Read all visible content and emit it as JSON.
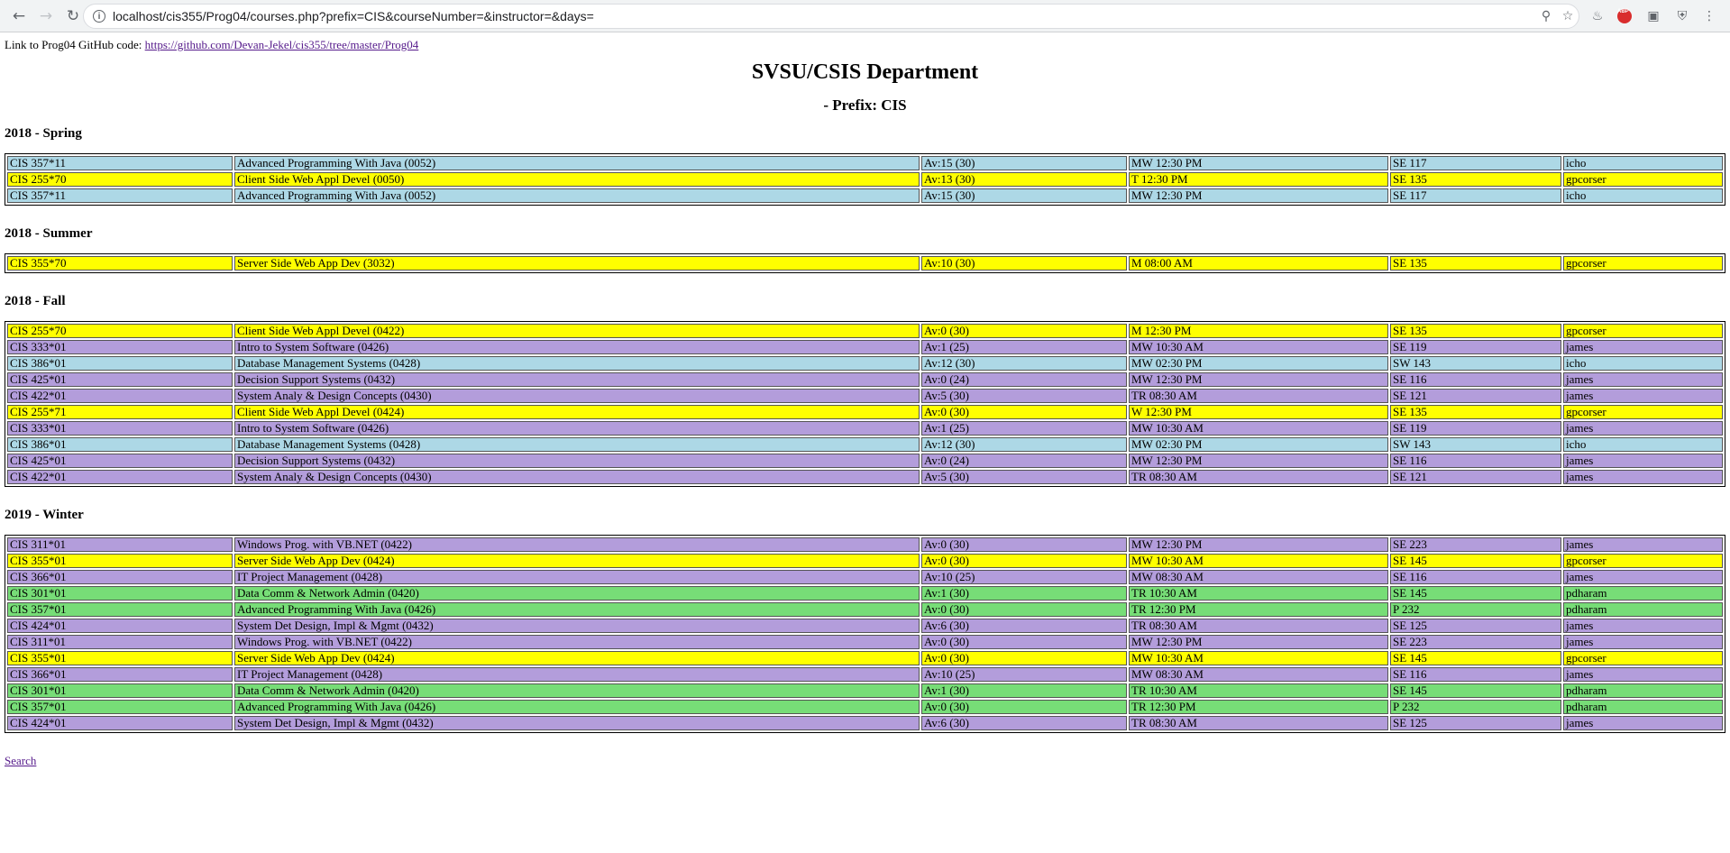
{
  "browser": {
    "url": "localhost/cis355/Prog04/courses.php?prefix=CIS&courseNumber=&instructor=&days="
  },
  "page": {
    "github_label": "Link to Prog04 GitHub code: ",
    "github_link": "https://github.com/Devan-Jekel/cis355/tree/master/Prog04",
    "title": "SVSU/CSIS Department",
    "subtitle": "- Prefix: CIS",
    "search_link": "Search"
  },
  "colors": {
    "blue": "#add8e6",
    "yellow": "#ffff00",
    "purple": "#b39ddb",
    "green": "#77dd77"
  },
  "terms": [
    {
      "title": "2018 - Spring",
      "rows": [
        {
          "color": "blue",
          "course": "CIS 357*11",
          "title": "Advanced Programming With Java (0052)",
          "avail": "Av:15 (30)",
          "time": "MW 12:30 PM",
          "room": "SE 117",
          "instructor": "icho"
        },
        {
          "color": "yellow",
          "course": "CIS 255*70",
          "title": "Client Side Web Appl Devel (0050)",
          "avail": "Av:13 (30)",
          "time": "T 12:30 PM",
          "room": "SE 135",
          "instructor": "gpcorser"
        },
        {
          "color": "blue",
          "course": "CIS 357*11",
          "title": "Advanced Programming With Java (0052)",
          "avail": "Av:15 (30)",
          "time": "MW 12:30 PM",
          "room": "SE 117",
          "instructor": "icho"
        }
      ]
    },
    {
      "title": "2018 - Summer",
      "rows": [
        {
          "color": "yellow",
          "course": "CIS 355*70",
          "title": "Server Side Web App Dev (3032)",
          "avail": "Av:10 (30)",
          "time": "M 08:00 AM",
          "room": "SE 135",
          "instructor": "gpcorser"
        }
      ]
    },
    {
      "title": "2018 - Fall",
      "rows": [
        {
          "color": "yellow",
          "course": "CIS 255*70",
          "title": "Client Side Web Appl Devel (0422)",
          "avail": "Av:0 (30)",
          "time": "M 12:30 PM",
          "room": "SE 135",
          "instructor": "gpcorser"
        },
        {
          "color": "purple",
          "course": "CIS 333*01",
          "title": "Intro to System Software (0426)",
          "avail": "Av:1 (25)",
          "time": "MW 10:30 AM",
          "room": "SE 119",
          "instructor": "james"
        },
        {
          "color": "blue",
          "course": "CIS 386*01",
          "title": "Database Management Systems (0428)",
          "avail": "Av:12 (30)",
          "time": "MW 02:30 PM",
          "room": "SW 143",
          "instructor": "icho"
        },
        {
          "color": "purple",
          "course": "CIS 425*01",
          "title": "Decision Support Systems (0432)",
          "avail": "Av:0 (24)",
          "time": "MW 12:30 PM",
          "room": "SE 116",
          "instructor": "james"
        },
        {
          "color": "purple",
          "course": "CIS 422*01",
          "title": "System Analy & Design Concepts (0430)",
          "avail": "Av:5 (30)",
          "time": "TR 08:30 AM",
          "room": "SE 121",
          "instructor": "james"
        },
        {
          "color": "yellow",
          "course": "CIS 255*71",
          "title": "Client Side Web Appl Devel (0424)",
          "avail": "Av:0 (30)",
          "time": "W 12:30 PM",
          "room": "SE 135",
          "instructor": "gpcorser"
        },
        {
          "color": "purple",
          "course": "CIS 333*01",
          "title": "Intro to System Software (0426)",
          "avail": "Av:1 (25)",
          "time": "MW 10:30 AM",
          "room": "SE 119",
          "instructor": "james"
        },
        {
          "color": "blue",
          "course": "CIS 386*01",
          "title": "Database Management Systems (0428)",
          "avail": "Av:12 (30)",
          "time": "MW 02:30 PM",
          "room": "SW 143",
          "instructor": "icho"
        },
        {
          "color": "purple",
          "course": "CIS 425*01",
          "title": "Decision Support Systems (0432)",
          "avail": "Av:0 (24)",
          "time": "MW 12:30 PM",
          "room": "SE 116",
          "instructor": "james"
        },
        {
          "color": "purple",
          "course": "CIS 422*01",
          "title": "System Analy & Design Concepts (0430)",
          "avail": "Av:5 (30)",
          "time": "TR 08:30 AM",
          "room": "SE 121",
          "instructor": "james"
        }
      ]
    },
    {
      "title": "2019 - Winter",
      "rows": [
        {
          "color": "purple",
          "course": "CIS 311*01",
          "title": "Windows Prog. with VB.NET (0422)",
          "avail": "Av:0 (30)",
          "time": "MW 12:30 PM",
          "room": "SE 223",
          "instructor": "james"
        },
        {
          "color": "yellow",
          "course": "CIS 355*01",
          "title": "Server Side Web App Dev (0424)",
          "avail": "Av:0 (30)",
          "time": "MW 10:30 AM",
          "room": "SE 145",
          "instructor": "gpcorser"
        },
        {
          "color": "purple",
          "course": "CIS 366*01",
          "title": "IT Project Management (0428)",
          "avail": "Av:10 (25)",
          "time": "MW 08:30 AM",
          "room": "SE 116",
          "instructor": "james"
        },
        {
          "color": "green",
          "course": "CIS 301*01",
          "title": "Data Comm & Network Admin (0420)",
          "avail": "Av:1 (30)",
          "time": "TR 10:30 AM",
          "room": "SE 145",
          "instructor": "pdharam"
        },
        {
          "color": "green",
          "course": "CIS 357*01",
          "title": "Advanced Programming With Java (0426)",
          "avail": "Av:0 (30)",
          "time": "TR 12:30 PM",
          "room": "P 232",
          "instructor": "pdharam"
        },
        {
          "color": "purple",
          "course": "CIS 424*01",
          "title": "System Det Design, Impl & Mgmt (0432)",
          "avail": "Av:6 (30)",
          "time": "TR 08:30 AM",
          "room": "SE 125",
          "instructor": "james"
        },
        {
          "color": "purple",
          "course": "CIS 311*01",
          "title": "Windows Prog. with VB.NET (0422)",
          "avail": "Av:0 (30)",
          "time": "MW 12:30 PM",
          "room": "SE 223",
          "instructor": "james"
        },
        {
          "color": "yellow",
          "course": "CIS 355*01",
          "title": "Server Side Web App Dev (0424)",
          "avail": "Av:0 (30)",
          "time": "MW 10:30 AM",
          "room": "SE 145",
          "instructor": "gpcorser"
        },
        {
          "color": "purple",
          "course": "CIS 366*01",
          "title": "IT Project Management (0428)",
          "avail": "Av:10 (25)",
          "time": "MW 08:30 AM",
          "room": "SE 116",
          "instructor": "james"
        },
        {
          "color": "green",
          "course": "CIS 301*01",
          "title": "Data Comm & Network Admin (0420)",
          "avail": "Av:1 (30)",
          "time": "TR 10:30 AM",
          "room": "SE 145",
          "instructor": "pdharam"
        },
        {
          "color": "green",
          "course": "CIS 357*01",
          "title": "Advanced Programming With Java (0426)",
          "avail": "Av:0 (30)",
          "time": "TR 12:30 PM",
          "room": "P 232",
          "instructor": "pdharam"
        },
        {
          "color": "purple",
          "course": "CIS 424*01",
          "title": "System Det Design, Impl & Mgmt (0432)",
          "avail": "Av:6 (30)",
          "time": "TR 08:30 AM",
          "room": "SE 125",
          "instructor": "james"
        }
      ]
    }
  ]
}
